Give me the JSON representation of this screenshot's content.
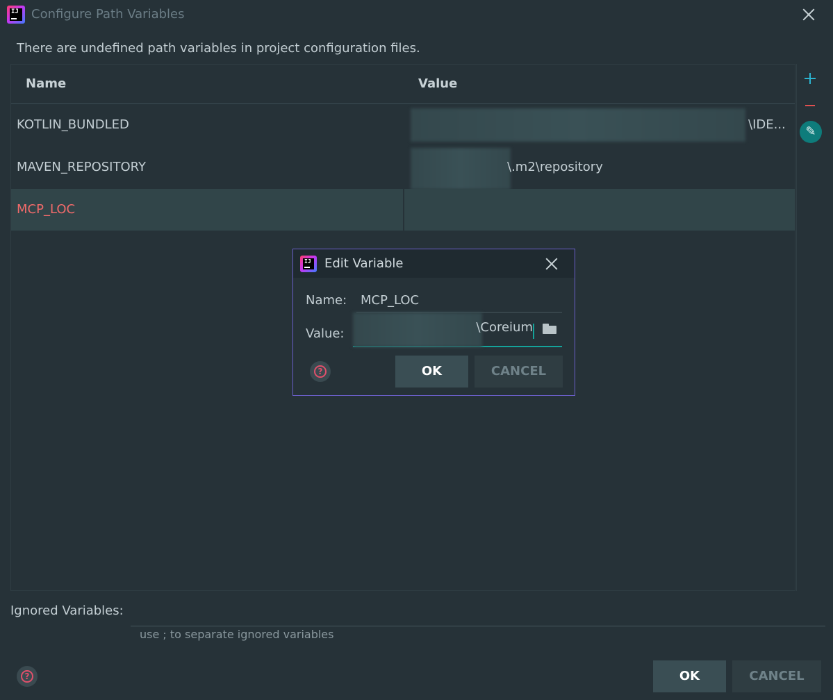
{
  "window": {
    "title": "Configure Path Variables",
    "notice": "There are undefined path variables in project configuration files."
  },
  "table": {
    "headers": {
      "name": "Name",
      "value": "Value"
    },
    "rows": [
      {
        "name": "KOTLIN_BUNDLED",
        "value": "\\IDE..."
      },
      {
        "name": "MAVEN_REPOSITORY",
        "value": "\\.m2\\repository"
      },
      {
        "name": "MCP_LOC",
        "value": ""
      }
    ]
  },
  "toolbar": {
    "add_icon": "plus-icon",
    "remove_icon": "minus-icon",
    "edit_icon": "pencil-icon"
  },
  "ignored": {
    "label": "Ignored Variables:",
    "value": "",
    "hint": "use ; to separate ignored variables"
  },
  "footer": {
    "ok_label": "OK",
    "cancel_label": "CANCEL"
  },
  "dialog": {
    "title": "Edit Variable",
    "name_label": "Name:",
    "name_value": "MCP_LOC",
    "value_label": "Value:",
    "value_text": "\\Coreium",
    "ok_label": "OK",
    "cancel_label": "CANCEL"
  },
  "colors": {
    "background": "#263238",
    "selected_row": "#314549",
    "undefined_variable": "#f06a6a",
    "accent_teal": "#14a39a",
    "dialog_border": "#6a5fc8",
    "add_blue": "#2bb4d0",
    "remove_red": "#e05050"
  }
}
